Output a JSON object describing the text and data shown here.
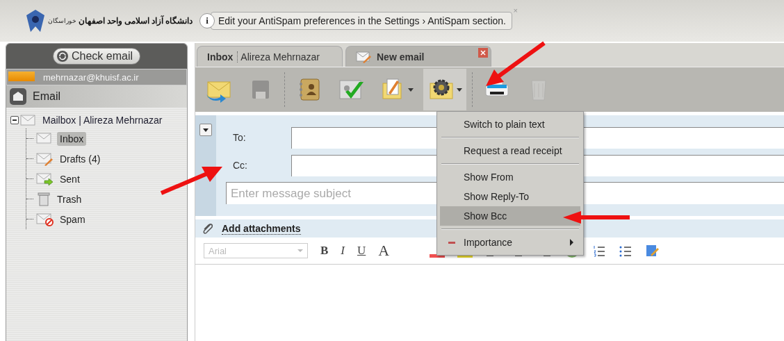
{
  "header": {
    "logo_text": "دانشگاه آزاد اسلامی واحد اصفهان",
    "logo_subtext": "خوراسگان",
    "notice": {
      "icon": "i",
      "text": "Edit your AntiSpam preferences in the Settings › AntiSpam section.",
      "close": "×"
    }
  },
  "sidebar": {
    "check_email": "Check email",
    "account": {
      "email": "mehrnazar@khuisf.ac.ir",
      "level": 0.15
    },
    "section": "Email",
    "tree": {
      "label": "Mailbox | Alireza Mehrnazar",
      "expanded": true,
      "children": [
        {
          "label": "Inbox",
          "kind": "inbox",
          "selected": true
        },
        {
          "label": "Drafts (4)",
          "kind": "drafts",
          "selected": false
        },
        {
          "label": "Sent",
          "kind": "sent",
          "selected": false
        },
        {
          "label": "Trash",
          "kind": "trash",
          "selected": false
        },
        {
          "label": "Spam",
          "kind": "spam",
          "selected": false
        }
      ]
    }
  },
  "tabs": [
    {
      "title": "Inbox",
      "subtitle": "Alireza Mehrnazar",
      "selected": false,
      "closable": false
    },
    {
      "title": "New email",
      "selected": true,
      "closable": true
    }
  ],
  "toolbar": [
    {
      "kind": "send",
      "disabled": false,
      "pressed": false,
      "dropdown": false
    },
    {
      "kind": "save",
      "disabled": true,
      "pressed": false,
      "dropdown": false
    },
    {
      "kind": "contacts",
      "disabled": false,
      "pressed": false,
      "dropdown": false
    },
    {
      "kind": "check",
      "disabled": false,
      "pressed": false,
      "dropdown": false
    },
    {
      "kind": "template",
      "disabled": false,
      "pressed": false,
      "dropdown": true
    },
    {
      "kind": "settings",
      "disabled": false,
      "pressed": true,
      "dropdown": true
    },
    {
      "kind": "print",
      "disabled": false,
      "pressed": false,
      "dropdown": false
    },
    {
      "kind": "delete",
      "disabled": true,
      "pressed": false,
      "dropdown": false
    }
  ],
  "compose": {
    "fields": [
      {
        "label": "To:"
      },
      {
        "label": "Cc:"
      }
    ],
    "subject": {
      "placeholder": "Enter message subject"
    },
    "attachments": "Add attachments",
    "format": {
      "font": "Arial",
      "buttons": [
        {
          "label": "B",
          "kind": "bold"
        },
        {
          "label": "I",
          "kind": "italic"
        },
        {
          "label": "U",
          "kind": "underline"
        },
        {
          "label": "A",
          "kind": "grow"
        }
      ]
    }
  },
  "menu": {
    "groups": [
      [
        {
          "label": "Switch to plain text",
          "highlighted": false,
          "submenu": false,
          "kind": "option"
        }
      ],
      [
        {
          "label": "Request a read receipt",
          "highlighted": false,
          "submenu": false,
          "kind": "option"
        }
      ],
      [
        {
          "label": "Show From",
          "highlighted": false,
          "submenu": false,
          "kind": "option"
        },
        {
          "label": "Show Reply-To",
          "highlighted": false,
          "submenu": false,
          "kind": "option"
        },
        {
          "label": "Show Bcc",
          "highlighted": true,
          "submenu": false,
          "kind": "option"
        }
      ],
      [
        {
          "label": "Importance",
          "highlighted": false,
          "submenu": true,
          "kind": "importance"
        }
      ]
    ]
  },
  "annotations": [
    {
      "kind": "arrow"
    },
    {
      "kind": "arrow"
    },
    {
      "kind": "arrow"
    }
  ]
}
